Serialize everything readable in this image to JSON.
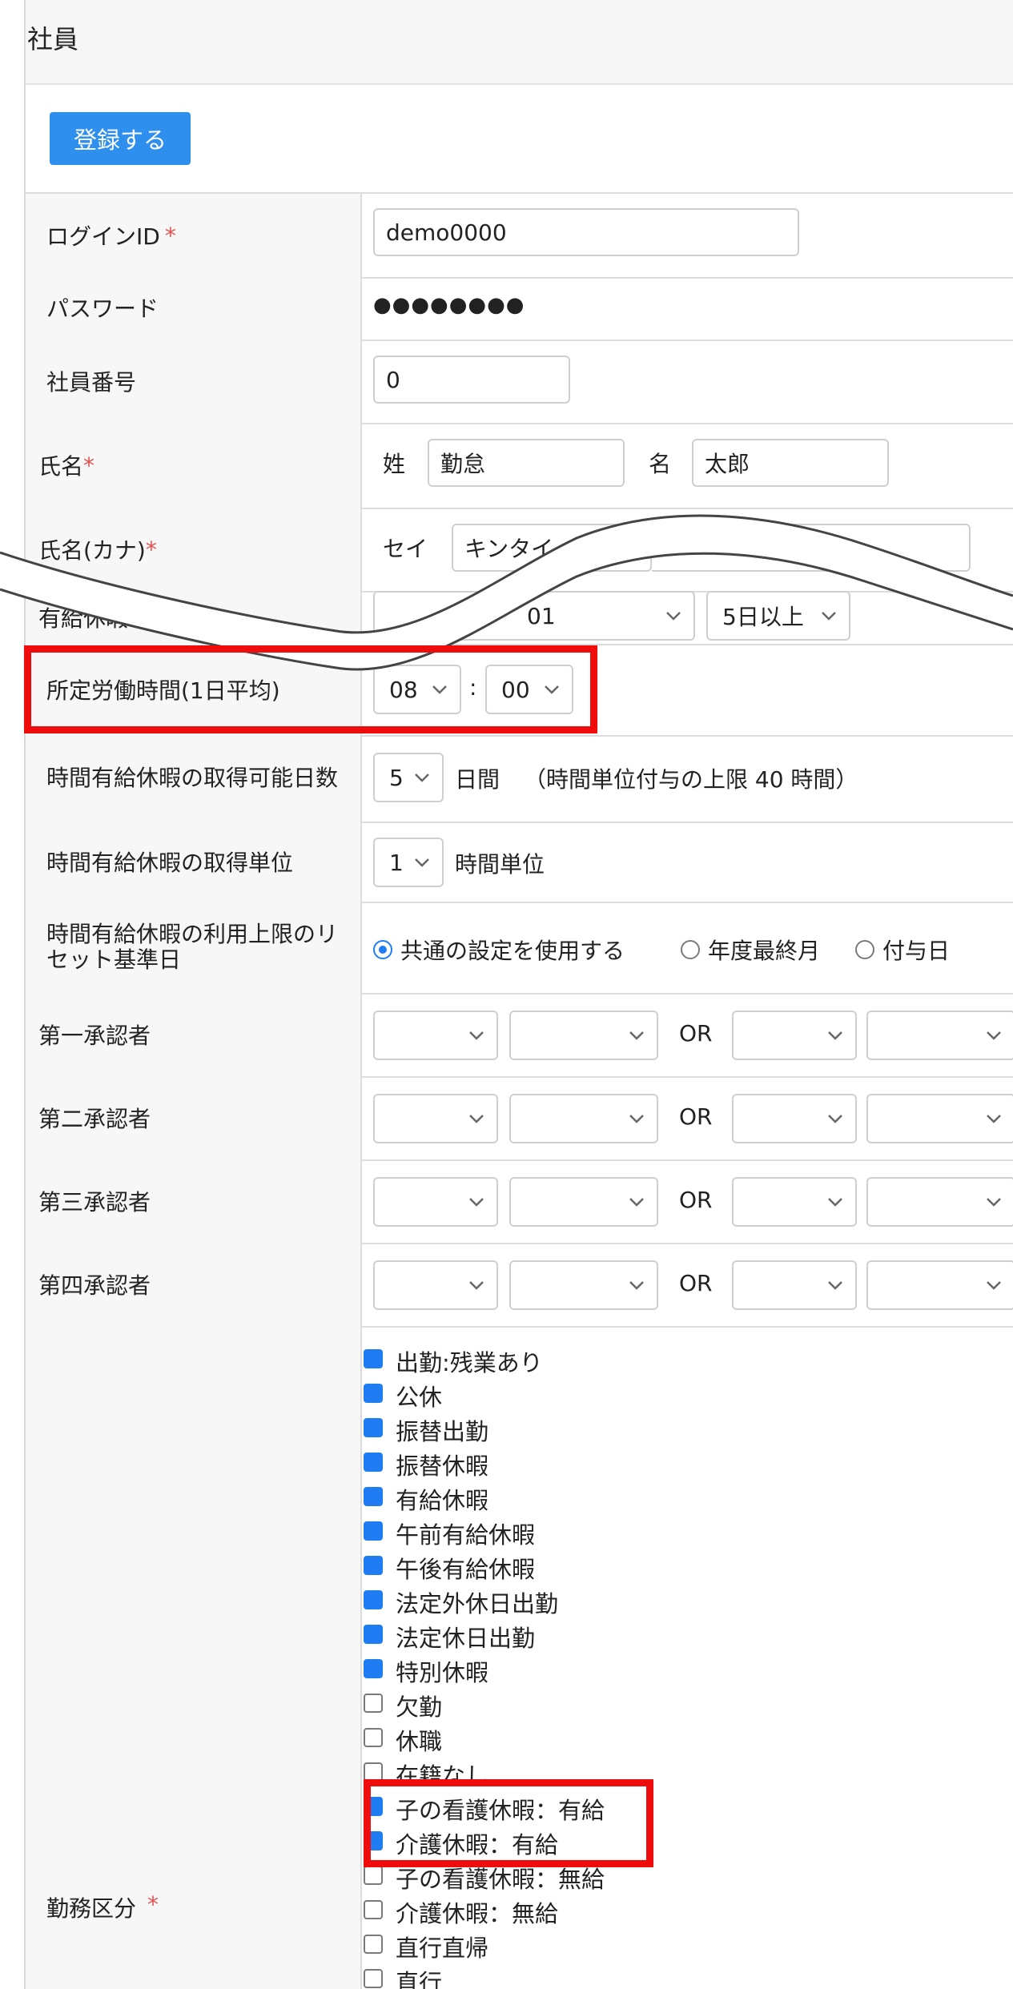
{
  "header": {
    "title": "社員"
  },
  "toolbar": {
    "register_label": "登録する"
  },
  "required_mark": "*",
  "fields": {
    "login_id": {
      "label": "ログインID",
      "value": "demo0000"
    },
    "password": {
      "label": "パスワード",
      "value": "●●●●●●●●"
    },
    "employee_number": {
      "label": "社員番号",
      "value": "0"
    },
    "name": {
      "label": "氏名",
      "surname_label": "姓",
      "surname_value": "勤怠",
      "given_label": "名",
      "given_value": "太郎"
    },
    "name_kana": {
      "label": "氏名(カナ)",
      "surname_label": "セイ",
      "surname_value": "キンタイ"
    },
    "paid_leave": {
      "label": "有給休暇 付",
      "select1_value": "01",
      "select2_value": "5日以上"
    },
    "scheduled_hours": {
      "label": "所定労働時間(1日平均)",
      "hour": "08",
      "separator": ":",
      "minute": "00"
    },
    "hourly_leave_days": {
      "label": "時間有給休暇の取得可能日数",
      "value": "5",
      "unit": "日間",
      "note": "（時間単位付与の上限 40 時間）"
    },
    "hourly_leave_unit": {
      "label": "時間有給休暇の取得単位",
      "value": "1",
      "unit": "時間単位"
    },
    "hourly_leave_reset": {
      "label": "時間有給休暇の利用上限のリセット基準日",
      "options": [
        {
          "label": "共通の設定を使用する",
          "selected": true
        },
        {
          "label": "年度最終月",
          "selected": false
        },
        {
          "label": "付与日",
          "selected": false
        }
      ]
    }
  },
  "approvers": {
    "or_label": "OR",
    "rows": [
      {
        "label": "第一承認者"
      },
      {
        "label": "第二承認者"
      },
      {
        "label": "第三承認者"
      },
      {
        "label": "第四承認者"
      }
    ]
  },
  "work_types": {
    "label": "勤務区分",
    "items": [
      {
        "label": "出勤:残業あり",
        "checked": true
      },
      {
        "label": "公休",
        "checked": true
      },
      {
        "label": "振替出勤",
        "checked": true
      },
      {
        "label": "振替休暇",
        "checked": true
      },
      {
        "label": "有給休暇",
        "checked": true
      },
      {
        "label": "午前有給休暇",
        "checked": true
      },
      {
        "label": "午後有給休暇",
        "checked": true
      },
      {
        "label": "法定外休日出勤",
        "checked": true
      },
      {
        "label": "法定休日出勤",
        "checked": true
      },
      {
        "label": "特別休暇",
        "checked": true
      },
      {
        "label": "欠勤",
        "checked": false
      },
      {
        "label": "休職",
        "checked": false
      },
      {
        "label": "在籍なし",
        "checked": false
      },
      {
        "label": "子の看護休暇：有給",
        "checked": true
      },
      {
        "label": "介護休暇：有給",
        "checked": true
      },
      {
        "label": "子の看護休暇：無給",
        "checked": false
      },
      {
        "label": "介護休暇：無給",
        "checked": false
      },
      {
        "label": "直行直帰",
        "checked": false
      },
      {
        "label": "直行",
        "checked": false
      }
    ]
  }
}
